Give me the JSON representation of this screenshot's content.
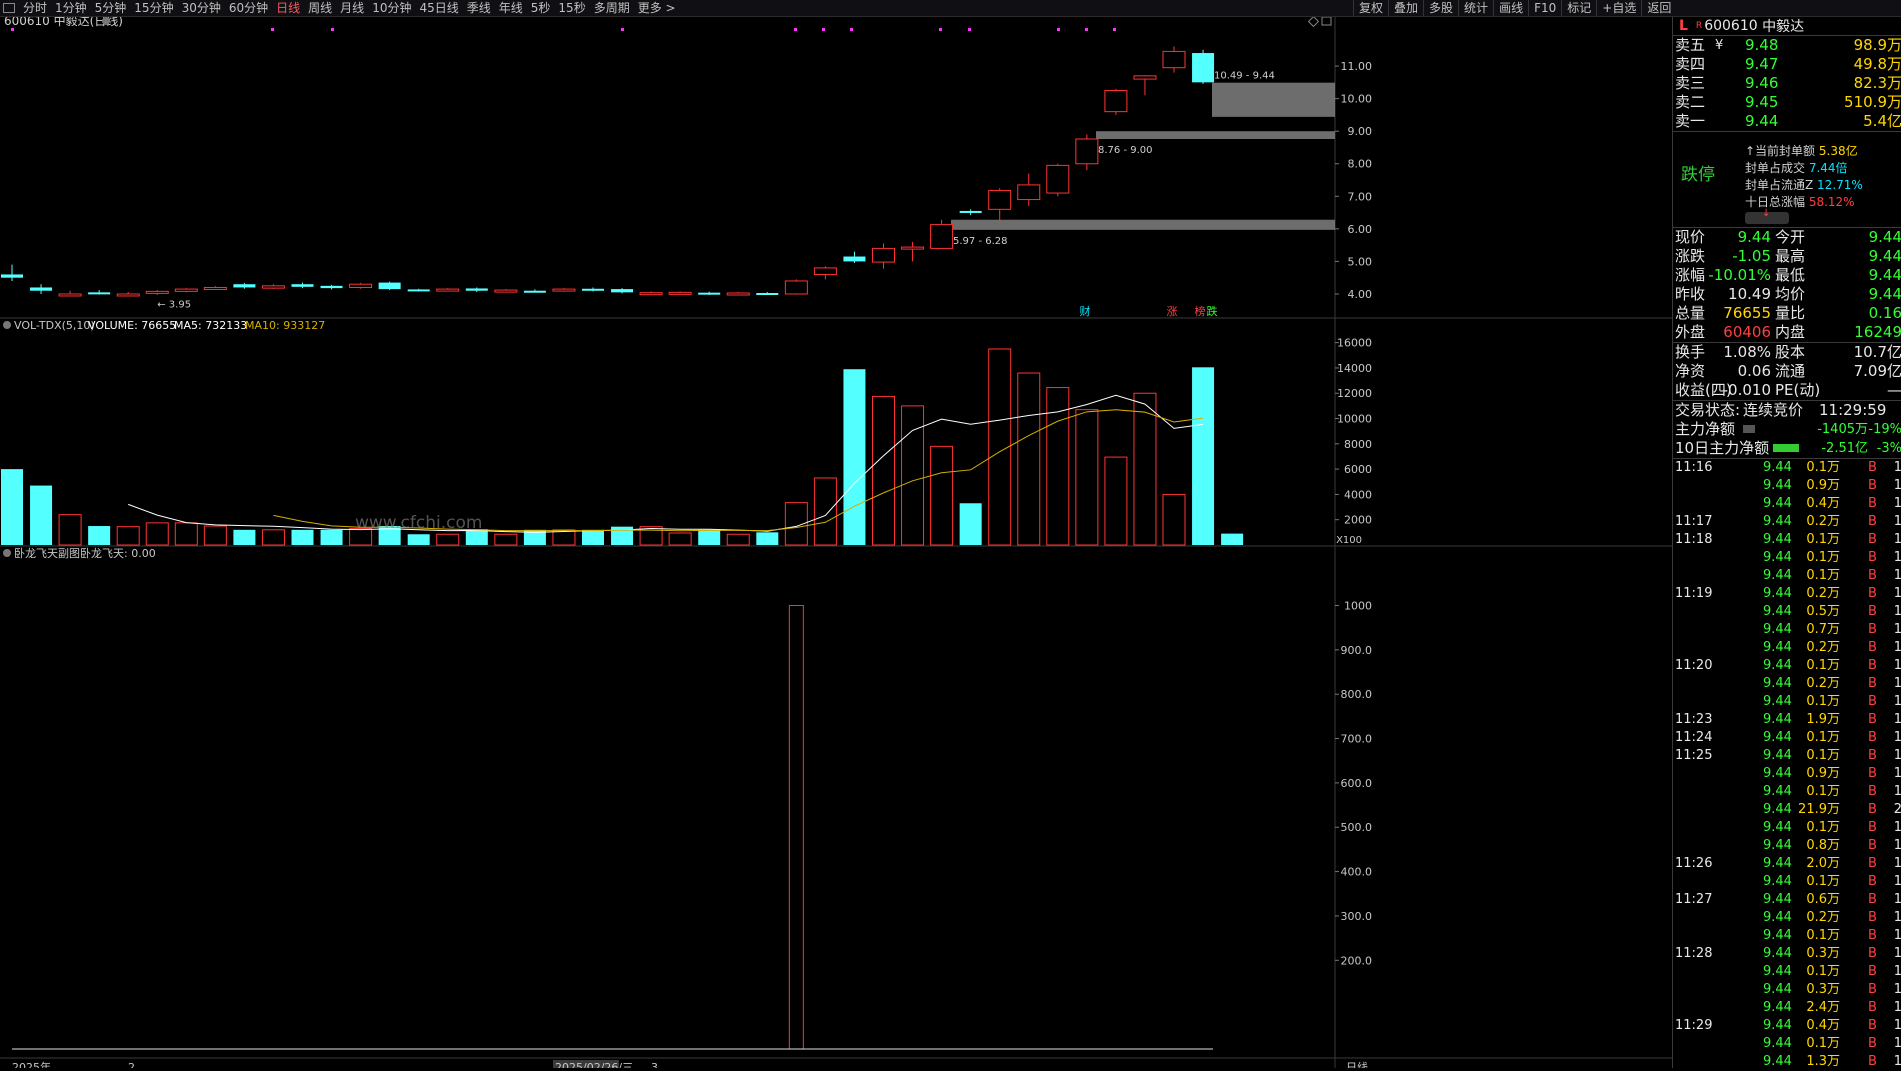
{
  "toolbar": {
    "periods": [
      "分时",
      "1分钟",
      "5分钟",
      "15分钟",
      "30分钟",
      "60分钟",
      "日线",
      "周线",
      "月线",
      "10分钟",
      "45日线",
      "季线",
      "年线",
      "5秒",
      "15秒",
      "多周期",
      "更多 >"
    ],
    "active_period": "日线",
    "right": [
      "复权",
      "叠加",
      "多股",
      "统计",
      "画线",
      "F10",
      "标记",
      "+自选",
      "返回"
    ]
  },
  "chart": {
    "title": "600610 中毅达(日线)",
    "price_axis": [
      "11.00",
      "10.00",
      "9.00",
      "8.00",
      "7.00",
      "6.00",
      "5.00",
      "4.00"
    ],
    "low_marker": "← 3.95",
    "gaps": [
      {
        "label": "10.49 - 9.44",
        "low": 9.44,
        "high": 10.49
      },
      {
        "label": "8.76 - 9.00",
        "low": 8.76,
        "high": 9.0
      },
      {
        "label": "5.97 - 6.28",
        "low": 5.97,
        "high": 6.28
      }
    ],
    "event_tags": [
      "财",
      "涨",
      "榜",
      "跌"
    ],
    "volume_header": {
      "name": "VOL-TDX(5,10)",
      "volume": "VOLUME: 76655",
      "ma5": "MA5: 732133",
      "ma10": "MA10: 933127"
    },
    "volume_axis": [
      "16000",
      "14000",
      "12000",
      "10000",
      "8000",
      "6000",
      "4000",
      "2000"
    ],
    "volume_unit": "X100",
    "watermark": "www.cfchi.com",
    "indicator_header": {
      "name": "卧龙飞天副图",
      "value": "卧龙飞天: 0.00"
    },
    "indicator_axis": [
      "1000",
      "900.0",
      "800.0",
      "700.0",
      "600.0",
      "500.0",
      "400.0",
      "300.0",
      "200.0"
    ],
    "date_labels": [
      "2025年",
      "2",
      "2025/02/26/三",
      "3"
    ],
    "period_label": "日线",
    "colors": {
      "up": "#ff3333",
      "down": "#54ffff",
      "ma5": "#ffffff",
      "ma10": "#d4b000",
      "gap": "#808080",
      "bg": "#000000"
    }
  },
  "chart_data": {
    "type": "candlestick",
    "series": [
      {
        "name": "K线",
        "values": [
          [
            4.6,
            4.5,
            4.9,
            4.4
          ],
          [
            4.2,
            4.1,
            4.3,
            4.0
          ],
          [
            4.0,
            4.0,
            4.1,
            3.95
          ],
          [
            4.05,
            4.0,
            4.12,
            3.98
          ],
          [
            4.0,
            4.0,
            4.06,
            3.96
          ],
          [
            4.02,
            4.08,
            4.12,
            3.97
          ],
          [
            4.08,
            4.15,
            4.18,
            4.05
          ],
          [
            4.15,
            4.2,
            4.24,
            4.12
          ],
          [
            4.3,
            4.2,
            4.34,
            4.16
          ],
          [
            4.18,
            4.25,
            4.3,
            4.15
          ],
          [
            4.3,
            4.22,
            4.35,
            4.18
          ],
          [
            4.25,
            4.18,
            4.28,
            4.14
          ],
          [
            4.2,
            4.3,
            4.34,
            4.16
          ],
          [
            4.35,
            4.15,
            4.38,
            4.12
          ],
          [
            4.14,
            4.12,
            4.16,
            4.08
          ],
          [
            4.12,
            4.15,
            4.18,
            4.09
          ],
          [
            4.17,
            4.1,
            4.2,
            4.06
          ],
          [
            4.1,
            4.12,
            4.15,
            4.07
          ],
          [
            4.1,
            4.08,
            4.14,
            4.05
          ],
          [
            4.1,
            4.15,
            4.18,
            4.07
          ],
          [
            4.16,
            4.12,
            4.2,
            4.08
          ],
          [
            4.15,
            4.05,
            4.18,
            4.02
          ],
          [
            4.0,
            4.04,
            4.08,
            3.98
          ],
          [
            4.02,
            4.05,
            4.08,
            4.0
          ],
          [
            4.04,
            4.0,
            4.07,
            3.97
          ],
          [
            4.0,
            4.03,
            4.06,
            3.98
          ],
          [
            4.03,
            4.0,
            4.06,
            3.97
          ],
          [
            4.0,
            4.4,
            4.45,
            3.98
          ],
          [
            4.6,
            4.8,
            4.85,
            4.45
          ],
          [
            5.15,
            5.0,
            5.3,
            4.95
          ],
          [
            4.98,
            5.4,
            5.55,
            4.78
          ],
          [
            5.42,
            5.44,
            5.6,
            5.0
          ],
          [
            5.4,
            6.13,
            6.28,
            5.38
          ],
          [
            6.55,
            6.5,
            6.6,
            6.42
          ],
          [
            6.6,
            7.18,
            7.25,
            6.1
          ],
          [
            6.9,
            7.35,
            7.7,
            6.7
          ],
          [
            7.1,
            7.95,
            8.0,
            7.0
          ],
          [
            8.0,
            8.76,
            8.9,
            7.8
          ],
          [
            9.6,
            10.25,
            10.3,
            9.5
          ],
          [
            10.6,
            10.7,
            10.72,
            10.1
          ],
          [
            10.95,
            11.45,
            11.6,
            10.8
          ],
          [
            11.4,
            10.5,
            11.5,
            10.45
          ]
        ]
      },
      {
        "name": "VOLUME",
        "values": [
          6000,
          4700,
          2400,
          1500,
          1450,
          1750,
          1750,
          1500,
          1200,
          1200,
          1200,
          1200,
          1300,
          1500,
          850,
          850,
          1250,
          850,
          1200,
          1200,
          1200,
          1450,
          1450,
          950,
          1200,
          850,
          1000,
          3350,
          5300,
          13900,
          11750,
          11000,
          7800,
          3300,
          15500,
          13600,
          12450,
          10700,
          6950,
          12000,
          4000,
          14050,
          900
        ]
      },
      {
        "name": "卧龙飞天",
        "values": [
          0,
          0,
          0,
          0,
          0,
          0,
          0,
          0,
          0,
          0,
          0,
          0,
          0,
          0,
          0,
          0,
          0,
          0,
          0,
          0,
          0,
          0,
          0,
          0,
          0,
          0,
          0,
          1000,
          0,
          0,
          0,
          0,
          0,
          0,
          0,
          0,
          0,
          0,
          0,
          0,
          0,
          0,
          0
        ]
      }
    ],
    "ylim_price": [
      3.6,
      12.2
    ],
    "ylim_volume": [
      0,
      17000
    ],
    "ylim_indicator": [
      0,
      1080
    ]
  },
  "quote": {
    "code": "600610",
    "name": "中毅达",
    "flag": "L",
    "flag_r": "R",
    "asks": [
      {
        "label": "卖五",
        "mark": "¥",
        "price": "9.48",
        "vol": "98.9万"
      },
      {
        "label": "卖四",
        "mark": "",
        "price": "9.47",
        "vol": "49.8万"
      },
      {
        "label": "卖三",
        "mark": "",
        "price": "9.46",
        "vol": "82.3万"
      },
      {
        "label": "卖二",
        "mark": "",
        "price": "9.45",
        "vol": "510.9万"
      },
      {
        "label": "卖一",
        "mark": "",
        "price": "9.44",
        "vol": "5.4亿"
      }
    ],
    "seal": {
      "status": "跌停",
      "lines": [
        {
          "k": "↑当前封单额",
          "v": "5.38亿",
          "c": "y"
        },
        {
          "k": "封单占成交",
          "v": "7.44倍",
          "c": "c"
        },
        {
          "k": "封单占流通Z",
          "v": "12.71%",
          "c": "c"
        },
        {
          "k": "十日总涨幅",
          "v": "58.12%",
          "c": "r"
        }
      ]
    },
    "stats": [
      {
        "k": "现价",
        "v": "9.44",
        "vc": "g",
        "k2": "今开",
        "v2": "9.44",
        "v2c": "g"
      },
      {
        "k": "涨跌",
        "v": "-1.05",
        "vc": "g",
        "k2": "最高",
        "v2": "9.44",
        "v2c": "g"
      },
      {
        "k": "涨幅",
        "v": "-10.01%",
        "vc": "g",
        "k2": "最低",
        "v2": "9.44",
        "v2c": "g"
      },
      {
        "k": "昨收",
        "v": "10.49",
        "vc": "w",
        "k2": "均价",
        "v2": "9.44",
        "v2c": "g"
      },
      {
        "k": "总量",
        "v": "76655",
        "vc": "y",
        "k2": "量比",
        "v2": "0.16",
        "v2c": "g"
      },
      {
        "k": "外盘",
        "v": "60406",
        "vc": "r",
        "k2": "内盘",
        "v2": "16249",
        "v2c": "g"
      }
    ],
    "stats2": [
      {
        "k": "换手",
        "v": "1.08%",
        "k2": "股本",
        "v2": "10.7亿"
      },
      {
        "k": "净资",
        "v": "0.06",
        "k2": "流通",
        "v2": "7.09亿"
      },
      {
        "k": "收益(四)",
        "v": "-0.010",
        "k2": "PE(动)",
        "v2": "—"
      }
    ],
    "status": {
      "label": "交易状态:",
      "value": "连续竞价",
      "time": "11:29:59"
    },
    "flow": [
      {
        "k": "主力净额",
        "v": "-1405万",
        "p": "-19%"
      },
      {
        "k": "10日主力净额",
        "v": "-2.51亿",
        "p": "-3%"
      }
    ],
    "ticks": [
      {
        "t": "11:16",
        "p": "9.44",
        "v": "0.1万",
        "s": "B",
        "n": "1"
      },
      {
        "t": "",
        "p": "9.44",
        "v": "0.9万",
        "s": "B",
        "n": "1"
      },
      {
        "t": "",
        "p": "9.44",
        "v": "0.4万",
        "s": "B",
        "n": "1"
      },
      {
        "t": "11:17",
        "p": "9.44",
        "v": "0.2万",
        "s": "B",
        "n": "1"
      },
      {
        "t": "11:18",
        "p": "9.44",
        "v": "0.1万",
        "s": "B",
        "n": "1"
      },
      {
        "t": "",
        "p": "9.44",
        "v": "0.1万",
        "s": "B",
        "n": "1"
      },
      {
        "t": "",
        "p": "9.44",
        "v": "0.1万",
        "s": "B",
        "n": "1"
      },
      {
        "t": "11:19",
        "p": "9.44",
        "v": "0.2万",
        "s": "B",
        "n": "1"
      },
      {
        "t": "",
        "p": "9.44",
        "v": "0.5万",
        "s": "B",
        "n": "1"
      },
      {
        "t": "",
        "p": "9.44",
        "v": "0.7万",
        "s": "B",
        "n": "1"
      },
      {
        "t": "",
        "p": "9.44",
        "v": "0.2万",
        "s": "B",
        "n": "1"
      },
      {
        "t": "11:20",
        "p": "9.44",
        "v": "0.1万",
        "s": "B",
        "n": "1"
      },
      {
        "t": "",
        "p": "9.44",
        "v": "0.2万",
        "s": "B",
        "n": "1"
      },
      {
        "t": "",
        "p": "9.44",
        "v": "0.1万",
        "s": "B",
        "n": "1"
      },
      {
        "t": "11:23",
        "p": "9.44",
        "v": "1.9万",
        "s": "B",
        "n": "1"
      },
      {
        "t": "11:24",
        "p": "9.44",
        "v": "0.1万",
        "s": "B",
        "n": "1"
      },
      {
        "t": "11:25",
        "p": "9.44",
        "v": "0.1万",
        "s": "B",
        "n": "1"
      },
      {
        "t": "",
        "p": "9.44",
        "v": "0.9万",
        "s": "B",
        "n": "1"
      },
      {
        "t": "",
        "p": "9.44",
        "v": "0.1万",
        "s": "B",
        "n": "1"
      },
      {
        "t": "",
        "p": "9.44",
        "v": "21.9万",
        "s": "B",
        "n": "2"
      },
      {
        "t": "",
        "p": "9.44",
        "v": "0.1万",
        "s": "B",
        "n": "1"
      },
      {
        "t": "",
        "p": "9.44",
        "v": "0.8万",
        "s": "B",
        "n": "1"
      },
      {
        "t": "11:26",
        "p": "9.44",
        "v": "2.0万",
        "s": "B",
        "n": "1"
      },
      {
        "t": "",
        "p": "9.44",
        "v": "0.1万",
        "s": "B",
        "n": "1"
      },
      {
        "t": "11:27",
        "p": "9.44",
        "v": "0.6万",
        "s": "B",
        "n": "1"
      },
      {
        "t": "",
        "p": "9.44",
        "v": "0.2万",
        "s": "B",
        "n": "1"
      },
      {
        "t": "",
        "p": "9.44",
        "v": "0.1万",
        "s": "B",
        "n": "1"
      },
      {
        "t": "11:28",
        "p": "9.44",
        "v": "0.3万",
        "s": "B",
        "n": "1"
      },
      {
        "t": "",
        "p": "9.44",
        "v": "0.1万",
        "s": "B",
        "n": "1"
      },
      {
        "t": "",
        "p": "9.44",
        "v": "0.3万",
        "s": "B",
        "n": "1"
      },
      {
        "t": "",
        "p": "9.44",
        "v": "2.4万",
        "s": "B",
        "n": "1"
      },
      {
        "t": "11:29",
        "p": "9.44",
        "v": "0.4万",
        "s": "B",
        "n": "1"
      },
      {
        "t": "",
        "p": "9.44",
        "v": "0.1万",
        "s": "B",
        "n": "1"
      },
      {
        "t": "",
        "p": "9.44",
        "v": "1.3万",
        "s": "B",
        "n": "1"
      }
    ]
  }
}
